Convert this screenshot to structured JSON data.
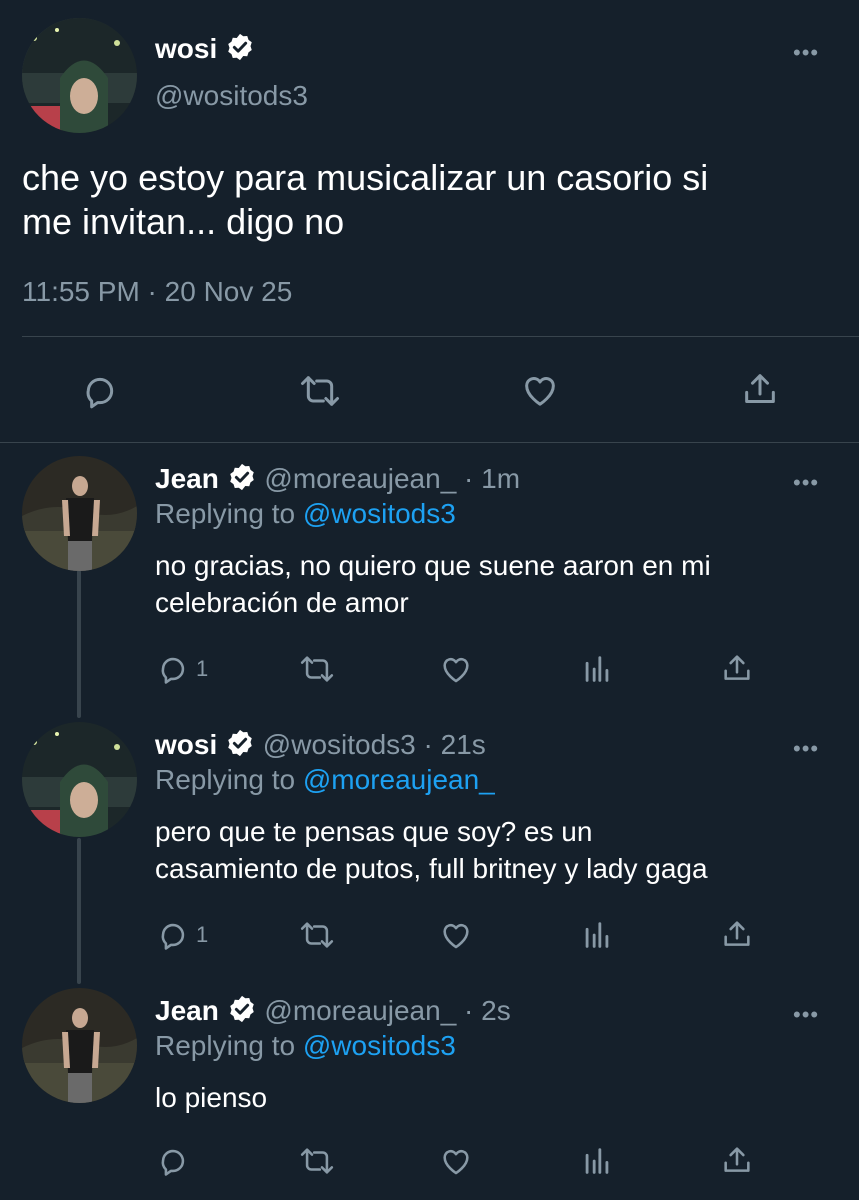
{
  "main_tweet": {
    "display_name": "wosi",
    "handle": "@wositods3",
    "text_line1": "che yo estoy para musicalizar un casorio si",
    "text_line2": "me invitan... digo no",
    "timestamp": "11:55 PM · 20 Nov 25"
  },
  "replies": [
    {
      "display_name": "Jean",
      "handle": "@moreaujean_",
      "time": "· 1m",
      "replying_prefix": "Replying to",
      "replying_to": "@wositods3",
      "text_line1": "no gracias, no quiero que suene aaron en mi",
      "text_line2": "celebración de amor",
      "reply_count": "1"
    },
    {
      "display_name": "wosi",
      "handle": "@wositods3",
      "time": "· 21s",
      "replying_prefix": "Replying to",
      "replying_to": "@moreaujean_",
      "text_line1": "pero que te pensas que soy? es un",
      "text_line2": "casamiento de putos, full britney y lady gaga",
      "reply_count": "1"
    },
    {
      "display_name": "Jean",
      "handle": "@moreaujean_",
      "time": "· 2s",
      "replying_prefix": "Replying to",
      "replying_to": "@wositods3",
      "text_line1": "lo pienso",
      "text_line2": "",
      "reply_count": ""
    }
  ],
  "colors": {
    "background": "#15202b",
    "muted": "#8899a6",
    "link": "#1da1f2",
    "divider": "#38444d"
  }
}
